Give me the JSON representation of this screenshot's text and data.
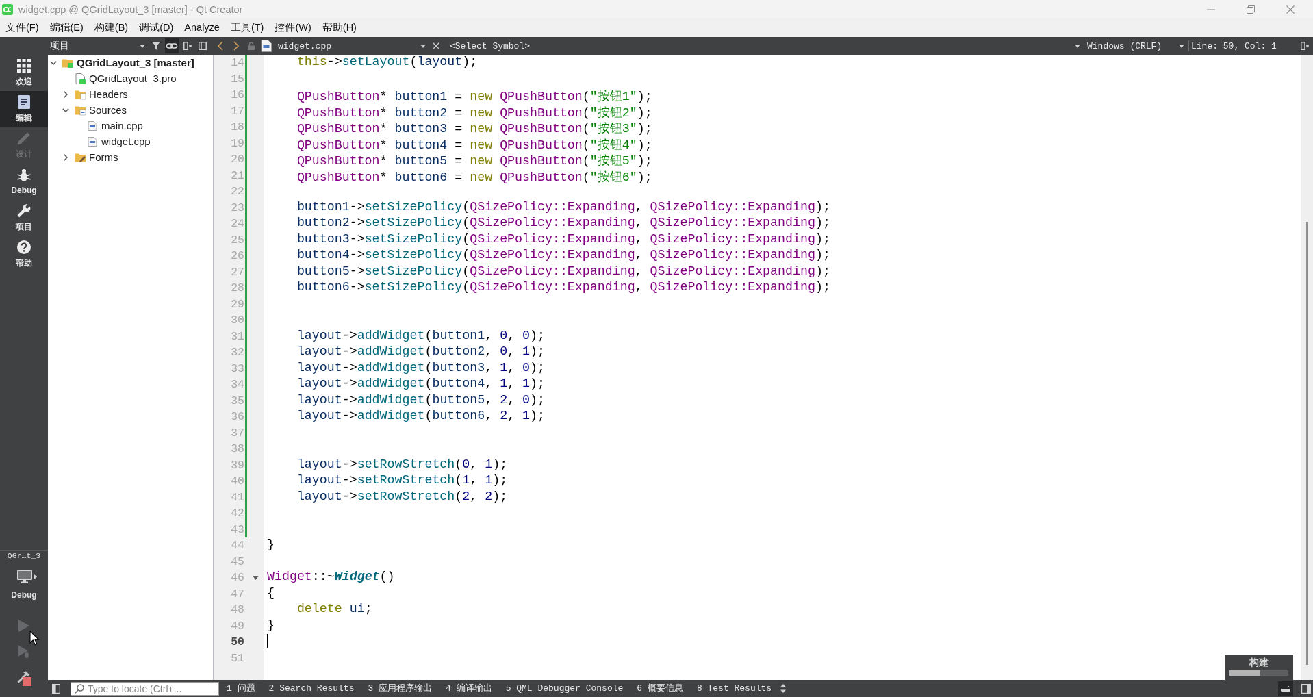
{
  "window": {
    "title": "widget.cpp @ QGridLayout_3 [master] - Qt Creator"
  },
  "menu_bar": [
    "文件(F)",
    "编辑(E)",
    "构建(B)",
    "调试(D)",
    "Analyze",
    "工具(T)",
    "控件(W)",
    "帮助(H)"
  ],
  "mode_bar": {
    "modes": [
      {
        "label": "欢迎",
        "kind": "welcome",
        "selected": false,
        "disabled": false
      },
      {
        "label": "编辑",
        "kind": "edit",
        "selected": true,
        "disabled": false
      },
      {
        "label": "设计",
        "kind": "design",
        "selected": false,
        "disabled": true
      },
      {
        "label": "Debug",
        "kind": "debug",
        "selected": false,
        "disabled": false
      },
      {
        "label": "项目",
        "kind": "projects",
        "selected": false,
        "disabled": false
      },
      {
        "label": "帮助",
        "kind": "help",
        "selected": false,
        "disabled": false
      }
    ],
    "kit": {
      "project": "QGr…t_3",
      "build_config": "Debug"
    },
    "actions": [
      {
        "kind": "run",
        "disabled": true
      },
      {
        "kind": "debug",
        "disabled": true
      },
      {
        "kind": "build",
        "disabled": false
      }
    ]
  },
  "project_pane": {
    "view": "项目",
    "tree": [
      {
        "label": "QGridLayout_3 [master]",
        "kind": "project",
        "expanded": true,
        "children": [
          {
            "label": "QGridLayout_3.pro",
            "kind": "pro-file"
          },
          {
            "label": "Headers",
            "kind": "headers",
            "expanded": false
          },
          {
            "label": "Sources",
            "kind": "sources",
            "expanded": true,
            "children": [
              {
                "label": "main.cpp",
                "kind": "cpp-file"
              },
              {
                "label": "widget.cpp",
                "kind": "cpp-file"
              }
            ]
          },
          {
            "label": "Forms",
            "kind": "forms",
            "expanded": false
          }
        ]
      }
    ]
  },
  "editor": {
    "document": "widget.cpp",
    "symbol": "<Select Symbol>",
    "line_ending": "Windows (CRLF)",
    "position": "Line: 50, Col: 1",
    "lines": [
      {
        "number": "14",
        "modified": true,
        "fold_marker": false,
        "current": false,
        "code": [
          {
            "text": "    this",
            "kind": "keyword"
          },
          {
            "text": "->",
            "kind": "plain"
          },
          {
            "text": "setLayout",
            "kind": "function"
          },
          {
            "text": "(",
            "kind": "plain"
          },
          {
            "text": "layout",
            "kind": "variable"
          },
          {
            "text": ");",
            "kind": "plain"
          }
        ]
      },
      {
        "number": "15",
        "modified": true,
        "fold_marker": false,
        "current": false
      },
      {
        "number": "16",
        "modified": true,
        "fold_marker": false,
        "current": false,
        "code": [
          {
            "text": "    QPushButton",
            "kind": "type"
          },
          {
            "text": "* ",
            "kind": "plain"
          },
          {
            "text": "button1",
            "kind": "variable"
          },
          {
            "text": " = ",
            "kind": "plain"
          },
          {
            "text": "new",
            "kind": "keyword"
          },
          {
            "text": " QPushButton",
            "kind": "type"
          },
          {
            "text": "(",
            "kind": "plain"
          },
          {
            "text": "\"按钮1\"",
            "kind": "string"
          },
          {
            "text": ");",
            "kind": "plain"
          }
        ]
      },
      {
        "number": "17",
        "modified": true,
        "fold_marker": false,
        "current": false,
        "code": [
          {
            "text": "    QPushButton",
            "kind": "type"
          },
          {
            "text": "* ",
            "kind": "plain"
          },
          {
            "text": "button2",
            "kind": "variable"
          },
          {
            "text": " = ",
            "kind": "plain"
          },
          {
            "text": "new",
            "kind": "keyword"
          },
          {
            "text": " QPushButton",
            "kind": "type"
          },
          {
            "text": "(",
            "kind": "plain"
          },
          {
            "text": "\"按钮2\"",
            "kind": "string"
          },
          {
            "text": ");",
            "kind": "plain"
          }
        ]
      },
      {
        "number": "18",
        "modified": true,
        "fold_marker": false,
        "current": false,
        "code": [
          {
            "text": "    QPushButton",
            "kind": "type"
          },
          {
            "text": "* ",
            "kind": "plain"
          },
          {
            "text": "button3",
            "kind": "variable"
          },
          {
            "text": " = ",
            "kind": "plain"
          },
          {
            "text": "new",
            "kind": "keyword"
          },
          {
            "text": " QPushButton",
            "kind": "type"
          },
          {
            "text": "(",
            "kind": "plain"
          },
          {
            "text": "\"按钮3\"",
            "kind": "string"
          },
          {
            "text": ");",
            "kind": "plain"
          }
        ]
      },
      {
        "number": "19",
        "modified": true,
        "fold_marker": false,
        "current": false,
        "code": [
          {
            "text": "    QPushButton",
            "kind": "type"
          },
          {
            "text": "* ",
            "kind": "plain"
          },
          {
            "text": "button4",
            "kind": "variable"
          },
          {
            "text": " = ",
            "kind": "plain"
          },
          {
            "text": "new",
            "kind": "keyword"
          },
          {
            "text": " QPushButton",
            "kind": "type"
          },
          {
            "text": "(",
            "kind": "plain"
          },
          {
            "text": "\"按钮4\"",
            "kind": "string"
          },
          {
            "text": ");",
            "kind": "plain"
          }
        ]
      },
      {
        "number": "20",
        "modified": true,
        "fold_marker": false,
        "current": false,
        "code": [
          {
            "text": "    QPushButton",
            "kind": "type"
          },
          {
            "text": "* ",
            "kind": "plain"
          },
          {
            "text": "button5",
            "kind": "variable"
          },
          {
            "text": " = ",
            "kind": "plain"
          },
          {
            "text": "new",
            "kind": "keyword"
          },
          {
            "text": " QPushButton",
            "kind": "type"
          },
          {
            "text": "(",
            "kind": "plain"
          },
          {
            "text": "\"按钮5\"",
            "kind": "string"
          },
          {
            "text": ");",
            "kind": "plain"
          }
        ]
      },
      {
        "number": "21",
        "modified": true,
        "fold_marker": false,
        "current": false,
        "code": [
          {
            "text": "    QPushButton",
            "kind": "type"
          },
          {
            "text": "* ",
            "kind": "plain"
          },
          {
            "text": "button6",
            "kind": "variable"
          },
          {
            "text": " = ",
            "kind": "plain"
          },
          {
            "text": "new",
            "kind": "keyword"
          },
          {
            "text": " QPushButton",
            "kind": "type"
          },
          {
            "text": "(",
            "kind": "plain"
          },
          {
            "text": "\"按钮6\"",
            "kind": "string"
          },
          {
            "text": ");",
            "kind": "plain"
          }
        ]
      },
      {
        "number": "22",
        "modified": true,
        "fold_marker": false,
        "current": false
      },
      {
        "number": "23",
        "modified": true,
        "fold_marker": false,
        "current": false,
        "code": [
          {
            "text": "    button1",
            "kind": "variable"
          },
          {
            "text": "->",
            "kind": "plain"
          },
          {
            "text": "setSizePolicy",
            "kind": "function"
          },
          {
            "text": "(",
            "kind": "plain"
          },
          {
            "text": "QSizePolicy::Expanding",
            "kind": "type"
          },
          {
            "text": ", ",
            "kind": "plain"
          },
          {
            "text": "QSizePolicy::Expanding",
            "kind": "type"
          },
          {
            "text": ");",
            "kind": "plain"
          }
        ]
      },
      {
        "number": "24",
        "modified": true,
        "fold_marker": false,
        "current": false,
        "code": [
          {
            "text": "    button2",
            "kind": "variable"
          },
          {
            "text": "->",
            "kind": "plain"
          },
          {
            "text": "setSizePolicy",
            "kind": "function"
          },
          {
            "text": "(",
            "kind": "plain"
          },
          {
            "text": "QSizePolicy::Expanding",
            "kind": "type"
          },
          {
            "text": ", ",
            "kind": "plain"
          },
          {
            "text": "QSizePolicy::Expanding",
            "kind": "type"
          },
          {
            "text": ");",
            "kind": "plain"
          }
        ]
      },
      {
        "number": "25",
        "modified": true,
        "fold_marker": false,
        "current": false,
        "code": [
          {
            "text": "    button3",
            "kind": "variable"
          },
          {
            "text": "->",
            "kind": "plain"
          },
          {
            "text": "setSizePolicy",
            "kind": "function"
          },
          {
            "text": "(",
            "kind": "plain"
          },
          {
            "text": "QSizePolicy::Expanding",
            "kind": "type"
          },
          {
            "text": ", ",
            "kind": "plain"
          },
          {
            "text": "QSizePolicy::Expanding",
            "kind": "type"
          },
          {
            "text": ");",
            "kind": "plain"
          }
        ]
      },
      {
        "number": "26",
        "modified": true,
        "fold_marker": false,
        "current": false,
        "code": [
          {
            "text": "    button4",
            "kind": "variable"
          },
          {
            "text": "->",
            "kind": "plain"
          },
          {
            "text": "setSizePolicy",
            "kind": "function"
          },
          {
            "text": "(",
            "kind": "plain"
          },
          {
            "text": "QSizePolicy::Expanding",
            "kind": "type"
          },
          {
            "text": ", ",
            "kind": "plain"
          },
          {
            "text": "QSizePolicy::Expanding",
            "kind": "type"
          },
          {
            "text": ");",
            "kind": "plain"
          }
        ]
      },
      {
        "number": "27",
        "modified": true,
        "fold_marker": false,
        "current": false,
        "code": [
          {
            "text": "    button5",
            "kind": "variable"
          },
          {
            "text": "->",
            "kind": "plain"
          },
          {
            "text": "setSizePolicy",
            "kind": "function"
          },
          {
            "text": "(",
            "kind": "plain"
          },
          {
            "text": "QSizePolicy::Expanding",
            "kind": "type"
          },
          {
            "text": ", ",
            "kind": "plain"
          },
          {
            "text": "QSizePolicy::Expanding",
            "kind": "type"
          },
          {
            "text": ");",
            "kind": "plain"
          }
        ]
      },
      {
        "number": "28",
        "modified": true,
        "fold_marker": false,
        "current": false,
        "code": [
          {
            "text": "    button6",
            "kind": "variable"
          },
          {
            "text": "->",
            "kind": "plain"
          },
          {
            "text": "setSizePolicy",
            "kind": "function"
          },
          {
            "text": "(",
            "kind": "plain"
          },
          {
            "text": "QSizePolicy::Expanding",
            "kind": "type"
          },
          {
            "text": ", ",
            "kind": "plain"
          },
          {
            "text": "QSizePolicy::Expanding",
            "kind": "type"
          },
          {
            "text": ");",
            "kind": "plain"
          }
        ]
      },
      {
        "number": "29",
        "modified": true,
        "fold_marker": false,
        "current": false
      },
      {
        "number": "30",
        "modified": true,
        "fold_marker": false,
        "current": false
      },
      {
        "number": "31",
        "modified": true,
        "fold_marker": false,
        "current": false,
        "code": [
          {
            "text": "    layout",
            "kind": "variable"
          },
          {
            "text": "->",
            "kind": "plain"
          },
          {
            "text": "addWidget",
            "kind": "function"
          },
          {
            "text": "(",
            "kind": "plain"
          },
          {
            "text": "button1",
            "kind": "variable"
          },
          {
            "text": ", ",
            "kind": "plain"
          },
          {
            "text": "0",
            "kind": "number"
          },
          {
            "text": ", ",
            "kind": "plain"
          },
          {
            "text": "0",
            "kind": "number"
          },
          {
            "text": ");",
            "kind": "plain"
          }
        ]
      },
      {
        "number": "32",
        "modified": true,
        "fold_marker": false,
        "current": false,
        "code": [
          {
            "text": "    layout",
            "kind": "variable"
          },
          {
            "text": "->",
            "kind": "plain"
          },
          {
            "text": "addWidget",
            "kind": "function"
          },
          {
            "text": "(",
            "kind": "plain"
          },
          {
            "text": "button2",
            "kind": "variable"
          },
          {
            "text": ", ",
            "kind": "plain"
          },
          {
            "text": "0",
            "kind": "number"
          },
          {
            "text": ", ",
            "kind": "plain"
          },
          {
            "text": "1",
            "kind": "number"
          },
          {
            "text": ");",
            "kind": "plain"
          }
        ]
      },
      {
        "number": "33",
        "modified": true,
        "fold_marker": false,
        "current": false,
        "code": [
          {
            "text": "    layout",
            "kind": "variable"
          },
          {
            "text": "->",
            "kind": "plain"
          },
          {
            "text": "addWidget",
            "kind": "function"
          },
          {
            "text": "(",
            "kind": "plain"
          },
          {
            "text": "button3",
            "kind": "variable"
          },
          {
            "text": ", ",
            "kind": "plain"
          },
          {
            "text": "1",
            "kind": "number"
          },
          {
            "text": ", ",
            "kind": "plain"
          },
          {
            "text": "0",
            "kind": "number"
          },
          {
            "text": ");",
            "kind": "plain"
          }
        ]
      },
      {
        "number": "34",
        "modified": true,
        "fold_marker": false,
        "current": false,
        "code": [
          {
            "text": "    layout",
            "kind": "variable"
          },
          {
            "text": "->",
            "kind": "plain"
          },
          {
            "text": "addWidget",
            "kind": "function"
          },
          {
            "text": "(",
            "kind": "plain"
          },
          {
            "text": "button4",
            "kind": "variable"
          },
          {
            "text": ", ",
            "kind": "plain"
          },
          {
            "text": "1",
            "kind": "number"
          },
          {
            "text": ", ",
            "kind": "plain"
          },
          {
            "text": "1",
            "kind": "number"
          },
          {
            "text": ");",
            "kind": "plain"
          }
        ]
      },
      {
        "number": "35",
        "modified": true,
        "fold_marker": false,
        "current": false,
        "code": [
          {
            "text": "    layout",
            "kind": "variable"
          },
          {
            "text": "->",
            "kind": "plain"
          },
          {
            "text": "addWidget",
            "kind": "function"
          },
          {
            "text": "(",
            "kind": "plain"
          },
          {
            "text": "button5",
            "kind": "variable"
          },
          {
            "text": ", ",
            "kind": "plain"
          },
          {
            "text": "2",
            "kind": "number"
          },
          {
            "text": ", ",
            "kind": "plain"
          },
          {
            "text": "0",
            "kind": "number"
          },
          {
            "text": ");",
            "kind": "plain"
          }
        ]
      },
      {
        "number": "36",
        "modified": true,
        "fold_marker": false,
        "current": false,
        "code": [
          {
            "text": "    layout",
            "kind": "variable"
          },
          {
            "text": "->",
            "kind": "plain"
          },
          {
            "text": "addWidget",
            "kind": "function"
          },
          {
            "text": "(",
            "kind": "plain"
          },
          {
            "text": "button6",
            "kind": "variable"
          },
          {
            "text": ", ",
            "kind": "plain"
          },
          {
            "text": "2",
            "kind": "number"
          },
          {
            "text": ", ",
            "kind": "plain"
          },
          {
            "text": "1",
            "kind": "number"
          },
          {
            "text": ");",
            "kind": "plain"
          }
        ]
      },
      {
        "number": "37",
        "modified": true,
        "fold_marker": false,
        "current": false
      },
      {
        "number": "38",
        "modified": true,
        "fold_marker": false,
        "current": false
      },
      {
        "number": "39",
        "modified": true,
        "fold_marker": false,
        "current": false,
        "code": [
          {
            "text": "    layout",
            "kind": "variable"
          },
          {
            "text": "->",
            "kind": "plain"
          },
          {
            "text": "setRowStretch",
            "kind": "function"
          },
          {
            "text": "(",
            "kind": "plain"
          },
          {
            "text": "0",
            "kind": "number"
          },
          {
            "text": ", ",
            "kind": "plain"
          },
          {
            "text": "1",
            "kind": "number"
          },
          {
            "text": ");",
            "kind": "plain"
          }
        ]
      },
      {
        "number": "40",
        "modified": true,
        "fold_marker": false,
        "current": false,
        "code": [
          {
            "text": "    layout",
            "kind": "variable"
          },
          {
            "text": "->",
            "kind": "plain"
          },
          {
            "text": "setRowStretch",
            "kind": "function"
          },
          {
            "text": "(",
            "kind": "plain"
          },
          {
            "text": "1",
            "kind": "number"
          },
          {
            "text": ", ",
            "kind": "plain"
          },
          {
            "text": "1",
            "kind": "number"
          },
          {
            "text": ");",
            "kind": "plain"
          }
        ]
      },
      {
        "number": "41",
        "modified": true,
        "fold_marker": false,
        "current": false,
        "code": [
          {
            "text": "    layout",
            "kind": "variable"
          },
          {
            "text": "->",
            "kind": "plain"
          },
          {
            "text": "setRowStretch",
            "kind": "function"
          },
          {
            "text": "(",
            "kind": "plain"
          },
          {
            "text": "2",
            "kind": "number"
          },
          {
            "text": ", ",
            "kind": "plain"
          },
          {
            "text": "2",
            "kind": "number"
          },
          {
            "text": ");",
            "kind": "plain"
          }
        ]
      },
      {
        "number": "42",
        "modified": true,
        "fold_marker": false,
        "current": false
      },
      {
        "number": "43",
        "modified": true,
        "fold_marker": false,
        "current": false
      },
      {
        "number": "44",
        "modified": false,
        "fold_marker": false,
        "current": false,
        "code": [
          {
            "text": "}",
            "kind": "plain"
          }
        ]
      },
      {
        "number": "45",
        "modified": false,
        "fold_marker": false,
        "current": false
      },
      {
        "number": "46",
        "modified": false,
        "fold_marker": true,
        "current": false,
        "code": [
          {
            "text": "Widget",
            "kind": "type"
          },
          {
            "text": "::~",
            "kind": "plain"
          },
          {
            "text": "Widget",
            "kind": "declaration"
          },
          {
            "text": "()",
            "kind": "plain"
          }
        ]
      },
      {
        "number": "47",
        "modified": false,
        "fold_marker": false,
        "current": false,
        "code": [
          {
            "text": "{",
            "kind": "plain"
          }
        ]
      },
      {
        "number": "48",
        "modified": false,
        "fold_marker": false,
        "current": false,
        "code": [
          {
            "text": "    delete",
            "kind": "keyword"
          },
          {
            "text": " ui",
            "kind": "variable"
          },
          {
            "text": ";",
            "kind": "plain"
          }
        ]
      },
      {
        "number": "49",
        "modified": false,
        "fold_marker": false,
        "current": false,
        "code": [
          {
            "text": "}",
            "kind": "plain"
          }
        ]
      },
      {
        "number": "50",
        "modified": false,
        "fold_marker": false,
        "current": true
      },
      {
        "number": "51",
        "modified": false,
        "fold_marker": false,
        "current": false
      }
    ],
    "build_progress": {
      "label": "构建",
      "level": 0.52
    }
  },
  "status_bar": {
    "locate_placeholder": "Type to locate (Ctrl+...",
    "output_tabs": [
      {
        "number": "1",
        "label": "问题"
      },
      {
        "number": "2",
        "label": "Search Results"
      },
      {
        "number": "3",
        "label": "应用程序输出"
      },
      {
        "number": "4",
        "label": "编译输出"
      },
      {
        "number": "5",
        "label": "QML Debugger Console"
      },
      {
        "number": "6",
        "label": "概要信息"
      },
      {
        "number": "8",
        "label": "Test Results"
      }
    ]
  }
}
